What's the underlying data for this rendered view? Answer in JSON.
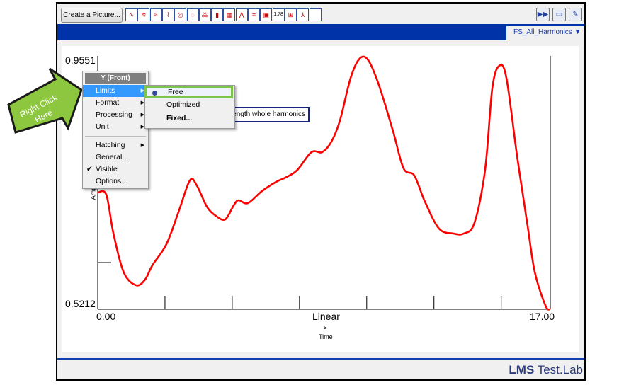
{
  "toolbar": {
    "create_picture": "Create a Picture...",
    "icons": [
      "line-display-icon",
      "overlay-display-icon",
      "stacked-display-icon",
      "front-back-display-icon",
      "polar-display-icon",
      "nyquist-display-icon",
      "waterfall-display-icon",
      "bar-display-icon",
      "colormap-display-icon",
      "3d-display-icon",
      "orders-display-icon",
      "geometry-display-icon",
      "value-display-icon",
      "table-display-icon",
      "axes-display-icon",
      "blank-display-icon"
    ],
    "tb_values": "1.78",
    "right_icons": [
      "forward-icon",
      "new-window-icon",
      "edit-icon"
    ]
  },
  "tab": {
    "label": "FS_All_Harmonics"
  },
  "chart": {
    "ymax": "0.9551",
    "ymin": "0.5212",
    "xmin": "0.00",
    "xmax": "17.00",
    "xscale": "Linear",
    "xunit": "s",
    "xlabel": "Time",
    "ylabel": "Amp",
    "legend": "ength whole harmonics",
    "line_color": "#ff0000"
  },
  "chart_data": {
    "type": "line",
    "xlabel": "Time",
    "xunit": "s",
    "ylabel": "Amp",
    "xlim": [
      0,
      17
    ],
    "ylim": [
      0.5212,
      0.9551
    ],
    "series": [
      {
        "x": [
          0,
          0.32,
          0.59,
          0.98,
          1.44,
          1.78,
          2.05,
          2.58,
          3.03,
          3.46,
          3.72,
          4.1,
          4.44,
          4.79,
          5.11,
          5.29,
          5.64,
          6.17,
          6.7,
          7.1,
          7.5,
          8.03,
          8.43,
          8.78,
          9.1,
          9.5,
          9.84,
          10.16,
          10.56,
          11.09,
          11.49,
          11.89,
          12.29,
          12.82,
          13.36,
          13.75,
          14.15,
          14.55,
          14.82,
          15.08,
          15.35,
          15.75,
          16.15,
          16.42,
          16.82,
          17.0
        ],
        "y": [
          0.7246,
          0.7209,
          0.6531,
          0.5853,
          0.5631,
          0.573,
          0.5976,
          0.6346,
          0.6901,
          0.7456,
          0.7369,
          0.6999,
          0.6839,
          0.6778,
          0.7024,
          0.711,
          0.7061,
          0.7271,
          0.7431,
          0.7517,
          0.764,
          0.7949,
          0.7949,
          0.8133,
          0.8503,
          0.9243,
          0.958,
          0.9551,
          0.912,
          0.8318,
          0.7665,
          0.7542,
          0.7086,
          0.6617,
          0.6531,
          0.6531,
          0.6716,
          0.764,
          0.9058,
          0.9452,
          0.9243,
          0.7887,
          0.6654,
          0.5853,
          0.5274,
          0.5212
        ]
      }
    ]
  },
  "context_menu": {
    "title": "Y (Front)",
    "items": [
      {
        "label": "Limits",
        "submenu": true
      },
      {
        "label": "Format",
        "submenu": true
      },
      {
        "label": "Processing",
        "submenu": true
      },
      {
        "label": "Unit",
        "submenu": true
      },
      {
        "label": "Hatching",
        "submenu": true
      },
      {
        "label": "General..."
      },
      {
        "label": "Visible",
        "checked": true
      },
      {
        "label": "Options..."
      }
    ]
  },
  "submenu": {
    "items": [
      {
        "label": "Free",
        "selected": true
      },
      {
        "label": "Optimized"
      },
      {
        "label": "Fixed..."
      }
    ]
  },
  "callout": {
    "text_line1": "Right Click",
    "text_line2": "Here",
    "color": "#8dc63f"
  },
  "footer": {
    "brand_bold": "LMS",
    "brand_rest": " Test.Lab"
  }
}
